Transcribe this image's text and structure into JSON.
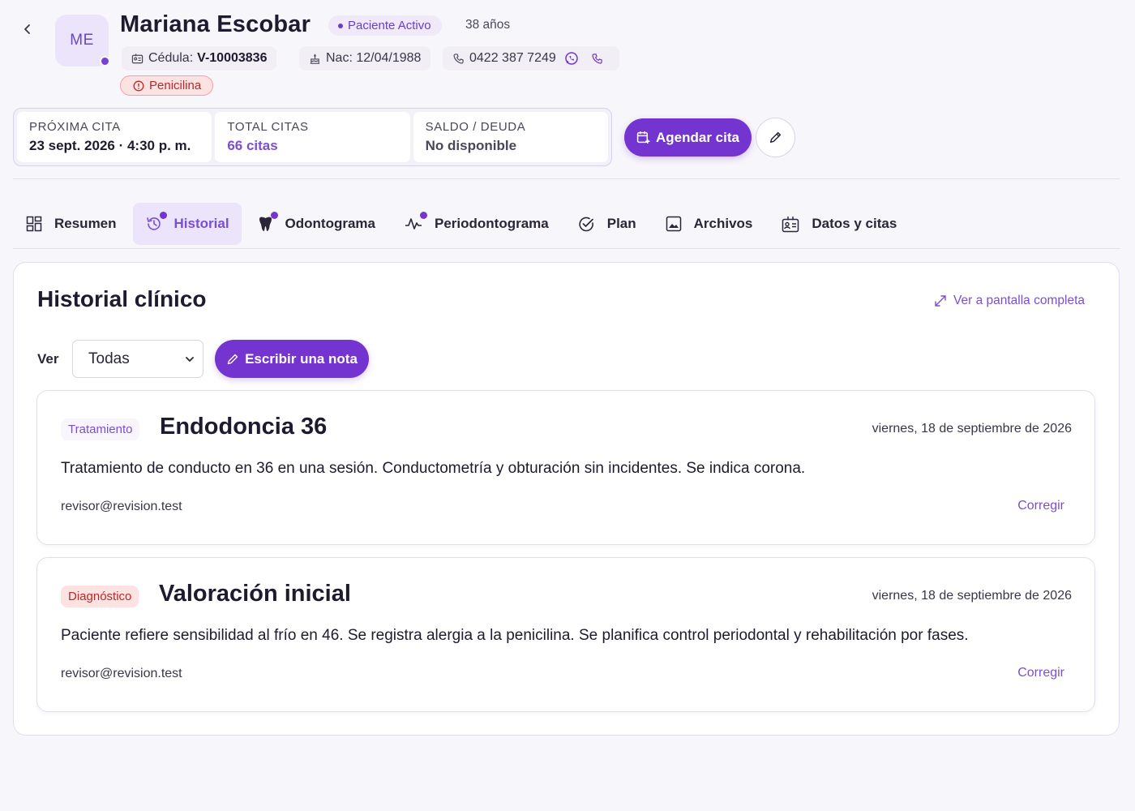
{
  "patient": {
    "initials": "ME",
    "name": "Mariana Escobar",
    "status": "Paciente Activo",
    "age": "38 años",
    "id_label": "Cédula:",
    "id_value": "V-10003836",
    "birth": "Nac: 12/04/1988",
    "phone": "0422 387 7249",
    "allergy": "Penicilina"
  },
  "stats": [
    {
      "label": "PRÓXIMA CITA",
      "value": "23 sept. 2026 · 4:30 p. m."
    },
    {
      "label": "TOTAL CITAS",
      "value": "66 citas"
    },
    {
      "label": "SALDO / DEUDA",
      "value": "No disponible"
    }
  ],
  "actions": {
    "schedule": "Agendar cita"
  },
  "tabs": [
    {
      "label": "Resumen",
      "icon": "grid-icon"
    },
    {
      "label": "Historial",
      "icon": "history-icon"
    },
    {
      "label": "Odontograma",
      "icon": "tooth-icon"
    },
    {
      "label": "Periodontograma",
      "icon": "chart-line-icon"
    },
    {
      "label": "Plan",
      "icon": "check-circle-icon"
    },
    {
      "label": "Archivos",
      "icon": "image-icon"
    },
    {
      "label": "Datos y citas",
      "icon": "id-card-icon"
    }
  ],
  "history": {
    "title": "Historial clínico",
    "fullscreen": "Ver a pantalla completa",
    "filter_label": "Ver",
    "filter_value": "Todas",
    "write_note": "Escribir una nota",
    "entries": [
      {
        "tag": "Tratamiento",
        "title": "Endodoncia 36",
        "date": "viernes, 18 de septiembre de 2026",
        "text": "Tratamiento de conducto en 36 en una sesión. Conductometría y obturación sin incidentes. Se indica corona.",
        "author": "revisor@revision.test",
        "edit": "Corregir"
      },
      {
        "tag": "Diagnóstico",
        "title": "Valoración inicial",
        "date": "viernes, 18 de septiembre de 2026",
        "text": "Paciente refiere sensibilidad al frío en 46. Se registra alergia a la penicilina. Se planifica control periodontal y rehabilitación por fases.",
        "author": "revisor@revision.test",
        "edit": "Corregir"
      }
    ]
  },
  "colors": {
    "accent": "#7434cf",
    "accent_light": "#ece4fa",
    "danger": "#b52a2a"
  }
}
